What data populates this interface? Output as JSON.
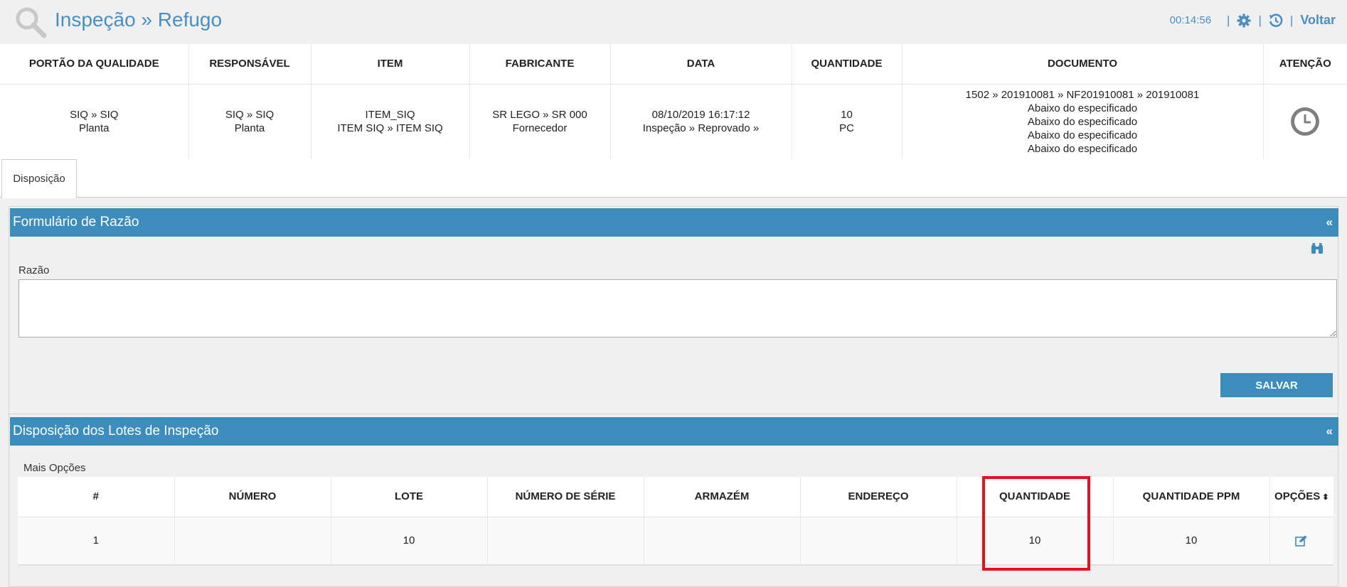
{
  "header": {
    "title": "Inspeção » Refugo",
    "timer": "00:14:56",
    "back_label": "Voltar",
    "icons": [
      "search-icon",
      "gear-icon",
      "history-icon"
    ]
  },
  "info_table": {
    "columns": [
      "PORTÃO DA QUALIDADE",
      "RESPONSÁVEL",
      "ITEM",
      "FABRICANTE",
      "DATA",
      "QUANTIDADE",
      "DOCUMENTO",
      "ATENÇÃO"
    ],
    "row": {
      "portao": [
        "SIQ » SIQ",
        "Planta"
      ],
      "responsavel": [
        "SIQ » SIQ",
        "Planta"
      ],
      "item": [
        "ITEM_SIQ",
        "ITEM SIQ » ITEM SIQ"
      ],
      "fabricante": [
        "SR LEGO » SR 000",
        "Fornecedor"
      ],
      "data": [
        "08/10/2019 16:17:12",
        "Inspeção » Reprovado »"
      ],
      "quantidade": [
        "10",
        "PC"
      ],
      "documento": [
        "1502 » 201910081 » NF201910081 » 201910081",
        "Abaixo do especificado",
        "Abaixo do especificado",
        "Abaixo do especificado",
        "Abaixo do especificado"
      ],
      "atencao_icon": "clock-icon"
    }
  },
  "tabs": [
    {
      "label": "Disposição",
      "active": true
    }
  ],
  "reason_form": {
    "title": "Formulário de Razão",
    "collapse_label": "«",
    "field_label": "Razão",
    "field_value": "",
    "save_label": "SALVAR",
    "search_icon": "binoculars-icon"
  },
  "lots_panel": {
    "title": "Disposição dos Lotes de Inspeção",
    "collapse_label": "«",
    "more_options": "Mais Opções",
    "columns": [
      "#",
      "NÚMERO",
      "LOTE",
      "NÚMERO DE SÉRIE",
      "ARMAZÉM",
      "ENDEREÇO",
      "QUANTIDADE",
      "QUANTIDADE PPM",
      "OPÇÕES"
    ],
    "sort_icon": "⬍",
    "rows": [
      {
        "num": "1",
        "numero": "",
        "lote": "10",
        "serie": "",
        "armazem": "",
        "endereco": "",
        "quantidade": "10",
        "ppm": "10",
        "option_icon": "edit-icon"
      }
    ]
  },
  "colors": {
    "accent": "#3d8dbc",
    "title_blue": "#4a8fc4",
    "highlight": "#e8101b",
    "background": "#f0f0f0"
  }
}
